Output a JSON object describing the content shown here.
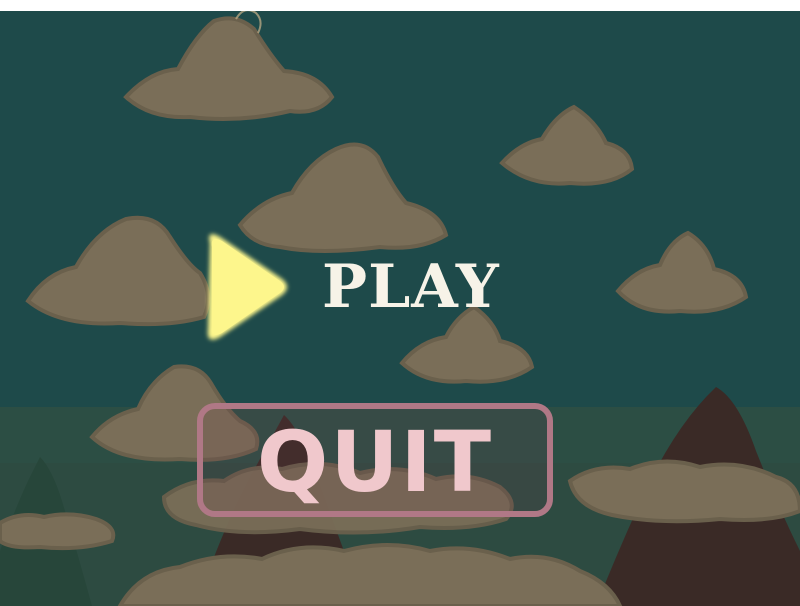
{
  "menu": {
    "play_label": "PLAY",
    "quit_label": "QUIT"
  },
  "colors": {
    "sky": "#1e4a4a",
    "horizon": "#2c4e44",
    "cloud": "#7a6e58",
    "cloud_shadow": "#6a604c",
    "mountain_dark": "#3a2a26",
    "mountain_green": "#27463a",
    "play_icon": "#fdf68c",
    "play_text": "#f7f3e8",
    "quit_text": "#f0c8cc",
    "quit_border": "#b07886"
  },
  "icons": {
    "play": "play-triangle-icon"
  }
}
